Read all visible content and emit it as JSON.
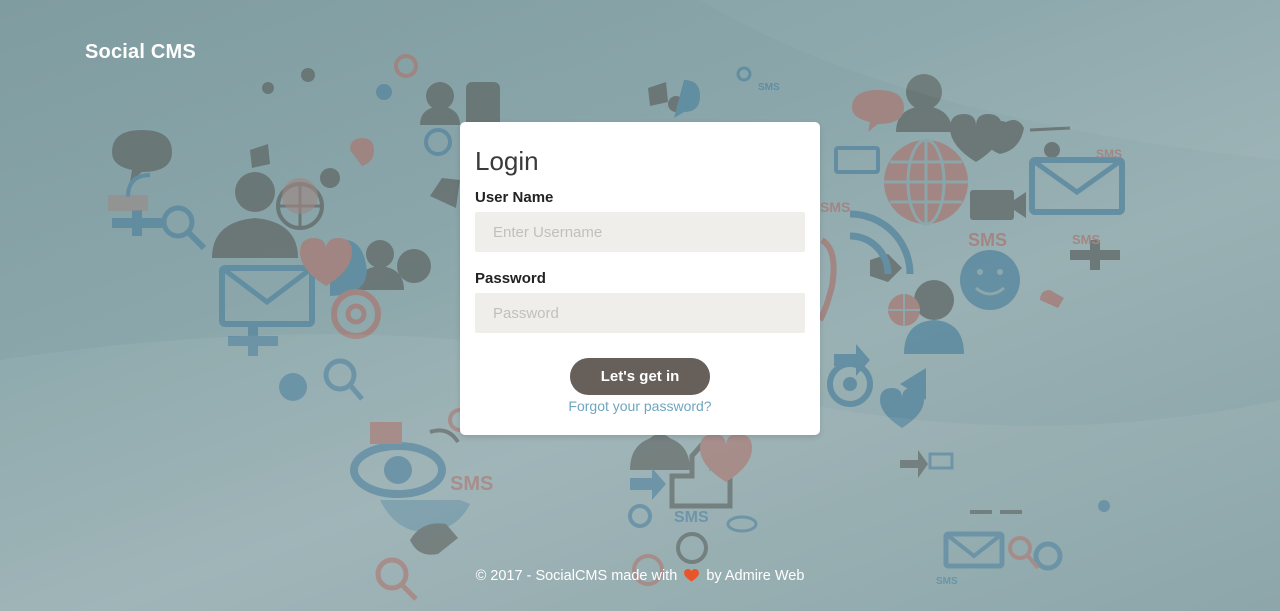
{
  "app": {
    "brand": "Social CMS"
  },
  "login": {
    "title": "Login",
    "username_label": "User Name",
    "username_placeholder": "Enter Username",
    "username_value": "",
    "password_label": "Password",
    "password_placeholder": "Password",
    "password_value": "",
    "submit_label": "Let's get in",
    "forgot_label": "Forgot your password?"
  },
  "footer": {
    "prefix": "© 2017 - SocialCMS made with",
    "suffix": "by Admire Web"
  },
  "icons": {
    "heart": "heart-icon",
    "background": "world-map-social-icons"
  },
  "colors": {
    "accent": "#675f59",
    "link": "#6fa6bf",
    "heart": "#e8552b",
    "input_bg": "#f0eeea",
    "map_blue": "#5c8aa0",
    "map_rose": "#a4807c",
    "map_gray": "#66706f"
  }
}
